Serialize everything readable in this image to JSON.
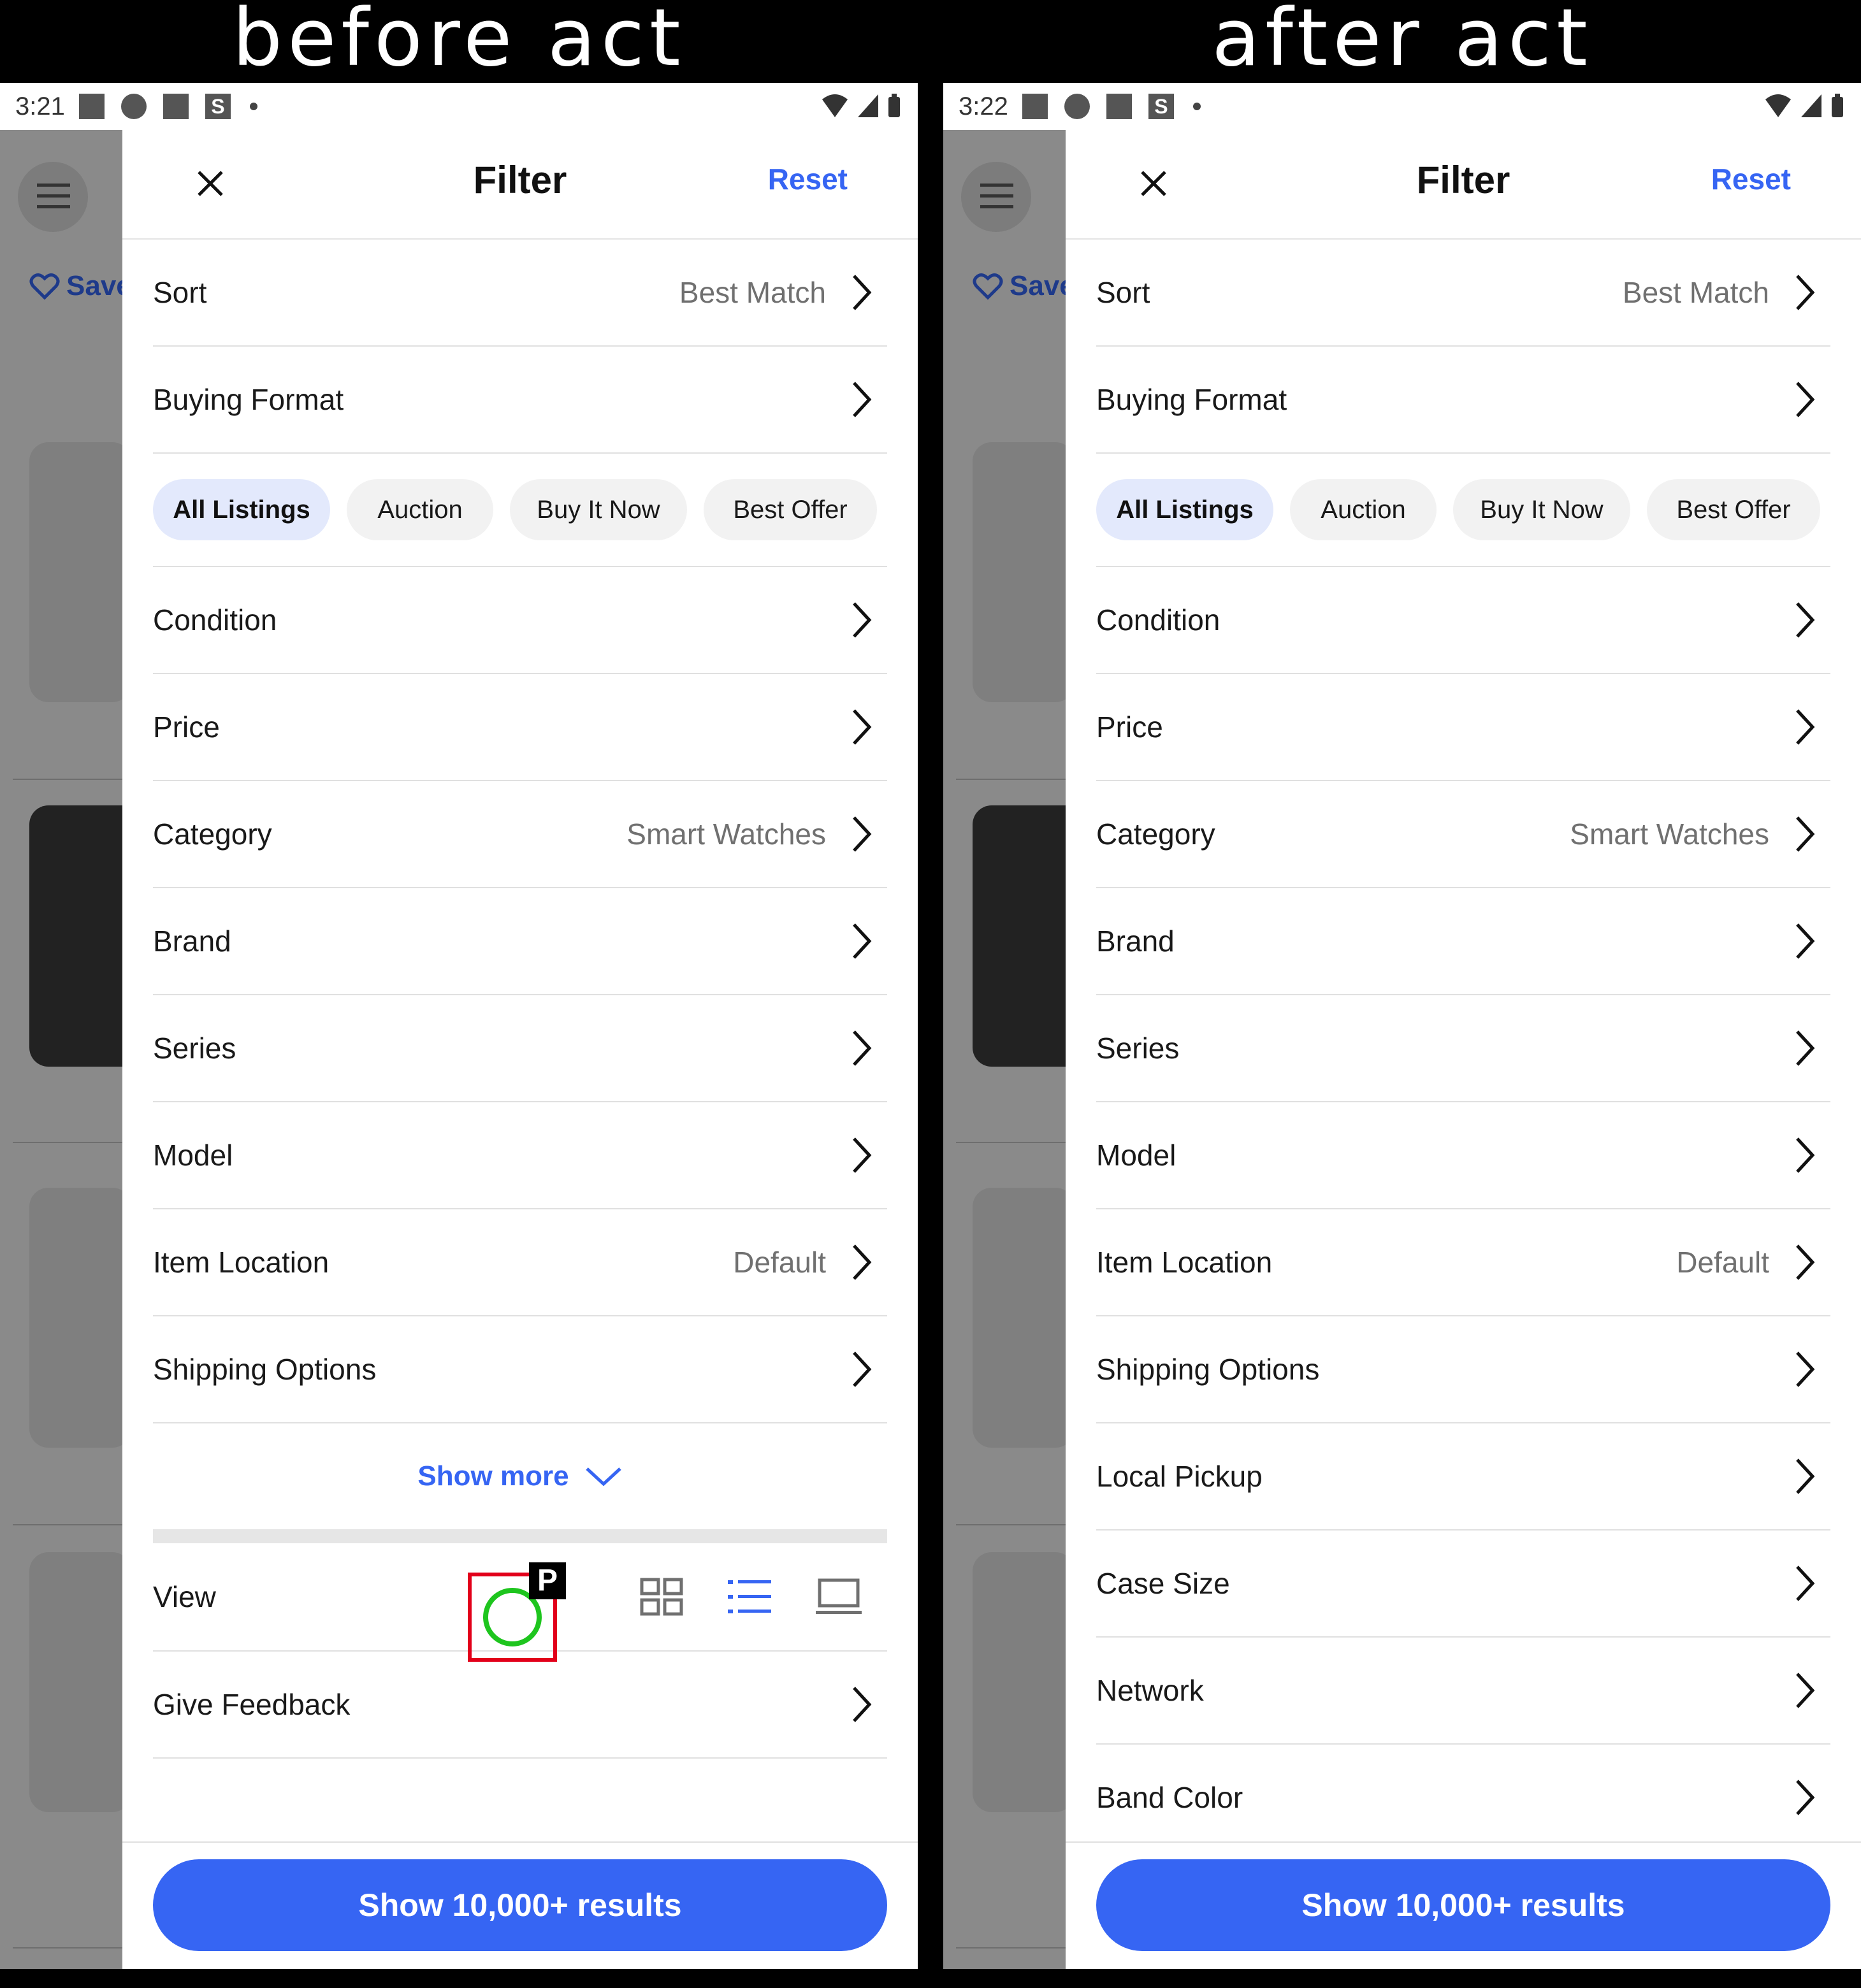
{
  "labels": {
    "before": "before act",
    "after": "after act"
  },
  "before": {
    "status": {
      "time": "3:21"
    },
    "backdrop": {
      "save_label": "Save"
    },
    "sheet": {
      "close_icon": "close-icon",
      "title": "Filter",
      "reset_label": "Reset",
      "sort": {
        "label": "Sort",
        "value": "Best Match"
      },
      "buying_format": {
        "label": "Buying Format"
      },
      "pills": [
        "All Listings",
        "Auction",
        "Buy It Now",
        "Best Offer"
      ],
      "selected_pill": "All Listings",
      "rows": [
        {
          "label": "Condition",
          "value": ""
        },
        {
          "label": "Price",
          "value": ""
        },
        {
          "label": "Category",
          "value": "Smart Watches"
        },
        {
          "label": "Brand",
          "value": ""
        },
        {
          "label": "Series",
          "value": ""
        },
        {
          "label": "Model",
          "value": ""
        },
        {
          "label": "Item Location",
          "value": "Default"
        },
        {
          "label": "Shipping Options",
          "value": ""
        }
      ],
      "show_more_label": "Show more",
      "view_label": "View",
      "feedback_label": "Give Feedback",
      "results_button": "Show 10,000+ results"
    },
    "tap_marker": "P"
  },
  "after": {
    "status": {
      "time": "3:22"
    },
    "backdrop": {
      "save_label": "Save"
    },
    "sheet": {
      "close_icon": "close-icon",
      "title": "Filter",
      "reset_label": "Reset",
      "sort": {
        "label": "Sort",
        "value": "Best Match"
      },
      "buying_format": {
        "label": "Buying Format"
      },
      "pills": [
        "All Listings",
        "Auction",
        "Buy It Now",
        "Best Offer"
      ],
      "selected_pill": "All Listings",
      "rows": [
        {
          "label": "Condition",
          "value": ""
        },
        {
          "label": "Price",
          "value": ""
        },
        {
          "label": "Category",
          "value": "Smart Watches"
        },
        {
          "label": "Brand",
          "value": ""
        },
        {
          "label": "Series",
          "value": ""
        },
        {
          "label": "Model",
          "value": ""
        },
        {
          "label": "Item Location",
          "value": "Default"
        },
        {
          "label": "Shipping Options",
          "value": ""
        },
        {
          "label": "Local Pickup",
          "value": ""
        },
        {
          "label": "Case Size",
          "value": ""
        },
        {
          "label": "Network",
          "value": ""
        },
        {
          "label": "Band Color",
          "value": ""
        }
      ],
      "results_button": "Show 10,000+ results"
    }
  },
  "colors": {
    "accent": "#3665f3",
    "pill_selected": "#e3e9fc",
    "tap_box": "#e2001a",
    "tap_circle": "#1ec51e"
  }
}
